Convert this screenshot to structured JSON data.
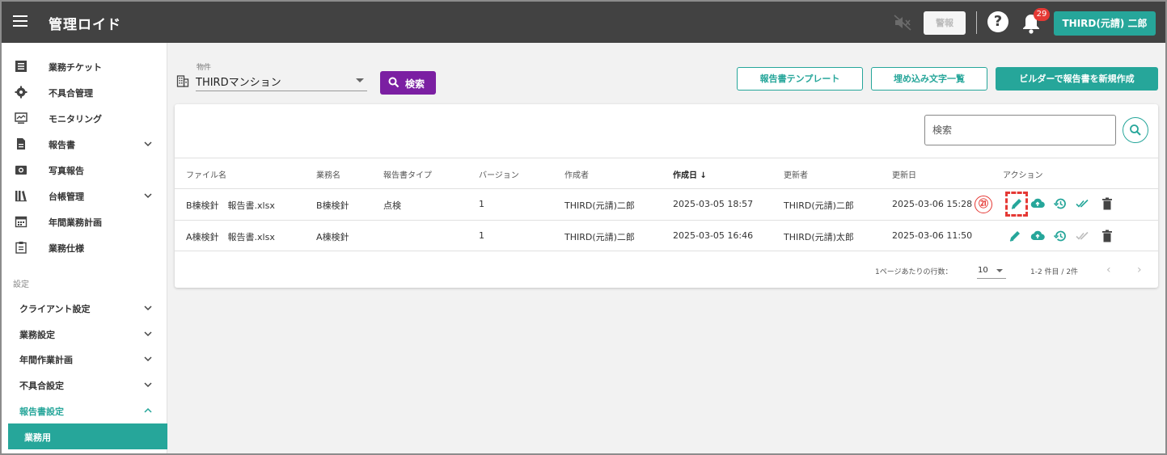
{
  "header": {
    "app_title": "管理ロイド",
    "alarm_label": "警報",
    "notification_count": "29",
    "user_label": "THIRD(元請) 二郎"
  },
  "sidebar": {
    "items": [
      {
        "label": "業務チケット",
        "icon": "list-icon"
      },
      {
        "label": "不具合管理",
        "icon": "gear-icon"
      },
      {
        "label": "モニタリング",
        "icon": "monitor-icon"
      },
      {
        "label": "報告書",
        "icon": "document-icon"
      },
      {
        "label": "写真報告",
        "icon": "camera-icon"
      },
      {
        "label": "台帳管理",
        "icon": "books-icon"
      },
      {
        "label": "年間業務計画",
        "icon": "calendar-icon"
      },
      {
        "label": "業務仕様",
        "icon": "clipboard-icon"
      }
    ],
    "settings_label": "設定",
    "settings_items": [
      {
        "label": "クライアント設定"
      },
      {
        "label": "業務設定"
      },
      {
        "label": "年間作業計画"
      },
      {
        "label": "不具合設定"
      },
      {
        "label": "報告書設定"
      }
    ],
    "active_sub_item": "業務用"
  },
  "toolbar": {
    "property_label": "物件",
    "property_value": "THIRDマンション",
    "search_label": "検索",
    "template_button": "報告書テンプレート",
    "embed_button": "埋め込み文字一覧",
    "builder_button": "ビルダーで報告書を新規作成"
  },
  "table": {
    "search_placeholder": "検索",
    "columns": [
      "ファイル名",
      "業務名",
      "報告書タイプ",
      "バージョン",
      "作成者",
      "作成日",
      "更新者",
      "更新日",
      "アクション"
    ],
    "sort_indicator": "↓",
    "rows": [
      {
        "file": "B棟検針　報告書.xlsx",
        "task": "B棟検針",
        "type": "点検",
        "version": "1",
        "creator": "THIRD(元請)二郎",
        "created": "2025-03-05 18:57",
        "updater": "THIRD(元請)二郎",
        "updated": "2025-03-06 15:28"
      },
      {
        "file": "A棟検針　報告書.xlsx",
        "task": "A棟検針",
        "type": "",
        "version": "1",
        "creator": "THIRD(元請)二郎",
        "created": "2025-03-05 16:46",
        "updater": "THIRD(元請)太郎",
        "updated": "2025-03-06 11:50"
      }
    ],
    "callout": "㉑",
    "accent_color": "#26a69a",
    "callout_color": "#e53935"
  },
  "pagination": {
    "rows_per_page_label": "1ページあたりの行数：",
    "rows_per_page": "10",
    "range": "1-2 件目 / 2件"
  }
}
